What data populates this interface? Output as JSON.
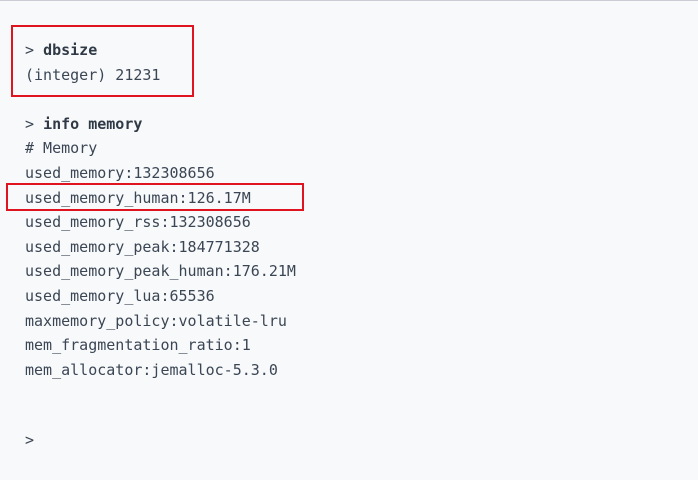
{
  "prompt_symbol": ">",
  "commands": {
    "dbsize": {
      "command": "dbsize",
      "result": "(integer) 21231"
    },
    "info_memory": {
      "command": "info memory",
      "section_header": "# Memory",
      "lines": [
        "used_memory:132308656",
        "used_memory_human:126.17M",
        "used_memory_rss:132308656",
        "used_memory_peak:184771328",
        "used_memory_peak_human:176.21M",
        "used_memory_lua:65536",
        "maxmemory_policy:volatile-lru",
        "mem_fragmentation_ratio:1",
        "mem_allocator:jemalloc-5.3.0"
      ]
    }
  },
  "colors": {
    "background": "#f8f9fb",
    "text": "#3b4654",
    "highlight": "#e0141e"
  }
}
